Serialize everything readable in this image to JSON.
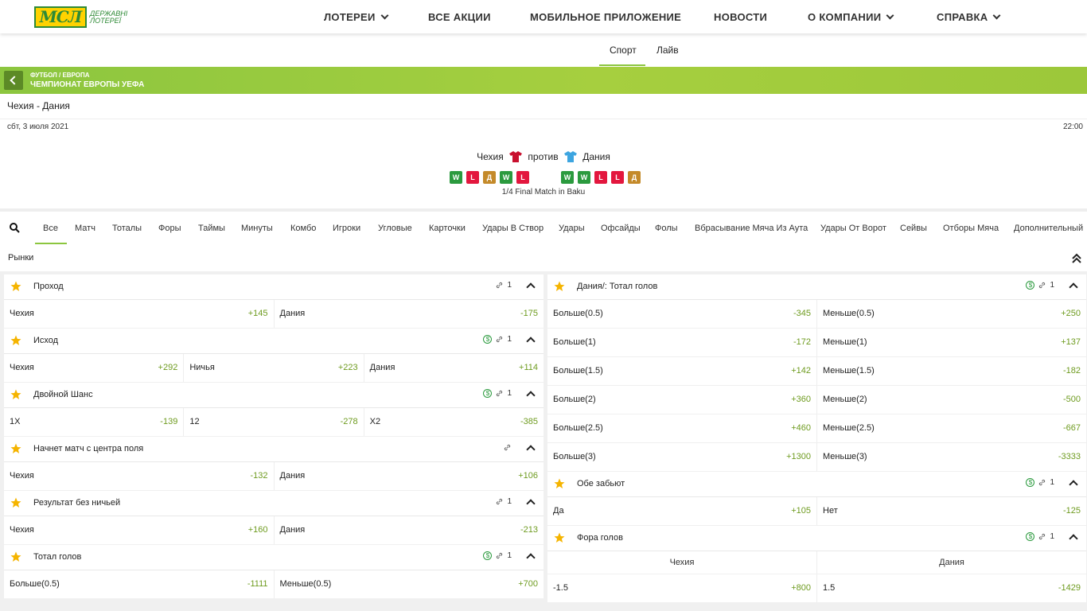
{
  "logo": {
    "mark": "МСЛ",
    "text_line1": "ДЕРЖАВНІ",
    "text_line2": "ЛОТЕРЕЇ",
    "brand_color": "#2e8a36",
    "accent_color": "#ffd200"
  },
  "nav": [
    {
      "label": "ЛОТЕРЕИ",
      "dropdown": true
    },
    {
      "label": "ВСЕ АКЦИИ",
      "dropdown": false
    },
    {
      "label": "МОБИЛЬНОЕ ПРИЛОЖЕНИЕ",
      "dropdown": false
    },
    {
      "label": "НОВОСТИ",
      "dropdown": false
    },
    {
      "label": "О КОМПАНИИ",
      "dropdown": true
    },
    {
      "label": "СПРАВКА",
      "dropdown": true
    }
  ],
  "subtabs": {
    "sport": "Спорт",
    "live": "Лайв",
    "active": "Спорт"
  },
  "banner": {
    "breadcrumb": "ФУТБОЛ / ЕВРОПА",
    "league": "ЧЕМПИОНАТ ЕВРОПЫ УЕФА",
    "color": "#8cc63f"
  },
  "match": {
    "title": "Чехия - Дания",
    "date": "сбт, 3 июля 2021",
    "time": "22:00",
    "home": "Чехия",
    "away": "Дания",
    "versus": "против",
    "home_form": [
      "W",
      "L",
      "Д",
      "W",
      "L"
    ],
    "away_form": [
      "W",
      "W",
      "L",
      "L",
      "Д"
    ],
    "round": "1/4 Final Match in Baku"
  },
  "filters": [
    "Все",
    "Матч",
    "Тоталы",
    "Форы",
    "Таймы",
    "Минуты",
    "Комбо",
    "Игроки",
    "Угловые",
    "Карточки",
    "Удары В Створ",
    "Удары",
    "Офсайды",
    "Фолы",
    "Вбрасывание Мяча Из Аута",
    "Удары От Ворот",
    "Сейвы",
    "Отборы Мяча",
    "Дополнительный"
  ],
  "markets_label": "Рынки",
  "left_markets": [
    {
      "title": "Проход",
      "dollar": false,
      "link_count": "1",
      "rows": [
        [
          {
            "label": "Чехия",
            "odd": "+145"
          },
          {
            "label": "Дания",
            "odd": "-175"
          }
        ]
      ]
    },
    {
      "title": "Исход",
      "dollar": true,
      "link_count": "1",
      "rows": [
        [
          {
            "label": "Чехия",
            "odd": "+292"
          },
          {
            "label": "Ничья",
            "odd": "+223"
          },
          {
            "label": "Дания",
            "odd": "+114"
          }
        ]
      ]
    },
    {
      "title": "Двойной Шанс",
      "dollar": true,
      "link_count": "1",
      "rows": [
        [
          {
            "label": "1X",
            "odd": "-139"
          },
          {
            "label": "12",
            "odd": "-278"
          },
          {
            "label": "X2",
            "odd": "-385"
          }
        ]
      ]
    },
    {
      "title": "Начнет матч с центра поля",
      "dollar": false,
      "link_count": "",
      "rows": [
        [
          {
            "label": "Чехия",
            "odd": "-132"
          },
          {
            "label": "Дания",
            "odd": "+106"
          }
        ]
      ]
    },
    {
      "title": "Результат без ничьей",
      "dollar": false,
      "link_count": "1",
      "rows": [
        [
          {
            "label": "Чехия",
            "odd": "+160"
          },
          {
            "label": "Дания",
            "odd": "-213"
          }
        ]
      ]
    },
    {
      "title": "Тотал голов",
      "dollar": true,
      "link_count": "1",
      "rows": [
        [
          {
            "label": "Больше(0.5)",
            "odd": "-1111"
          },
          {
            "label": "Меньше(0.5)",
            "odd": "+700"
          }
        ]
      ]
    }
  ],
  "right_markets": [
    {
      "title": "Дания/: Тотал голов",
      "dollar": true,
      "link_count": "1",
      "rows": [
        [
          {
            "label": "Больше(0.5)",
            "odd": "-345"
          },
          {
            "label": "Меньше(0.5)",
            "odd": "+250"
          }
        ],
        [
          {
            "label": "Больше(1)",
            "odd": "-172"
          },
          {
            "label": "Меньше(1)",
            "odd": "+137"
          }
        ],
        [
          {
            "label": "Больше(1.5)",
            "odd": "+142"
          },
          {
            "label": "Меньше(1.5)",
            "odd": "-182"
          }
        ],
        [
          {
            "label": "Больше(2)",
            "odd": "+360"
          },
          {
            "label": "Меньше(2)",
            "odd": "-500"
          }
        ],
        [
          {
            "label": "Больше(2.5)",
            "odd": "+460"
          },
          {
            "label": "Меньше(2.5)",
            "odd": "-667"
          }
        ],
        [
          {
            "label": "Больше(3)",
            "odd": "+1300"
          },
          {
            "label": "Меньше(3)",
            "odd": "-3333"
          }
        ]
      ]
    },
    {
      "title": "Обе забьют",
      "dollar": true,
      "link_count": "1",
      "rows": [
        [
          {
            "label": "Да",
            "odd": "+105"
          },
          {
            "label": "Нет",
            "odd": "-125"
          }
        ]
      ]
    },
    {
      "title": "Фора голов",
      "dollar": true,
      "link_count": "1",
      "header": [
        "Чехия",
        "Дания"
      ],
      "rows": [
        [
          {
            "label": "-1.5",
            "odd": "+800"
          },
          {
            "label": "1.5",
            "odd": "-1429"
          }
        ]
      ]
    }
  ],
  "colors": {
    "odd_green": "#6e9b1f",
    "star_gold": "#f5b400",
    "form_win": "#2b9a3e",
    "form_loss": "#e3173e",
    "form_draw": "#c48a2a",
    "home_shirt": "#c8102e",
    "away_shirt": "#3da5e0"
  }
}
